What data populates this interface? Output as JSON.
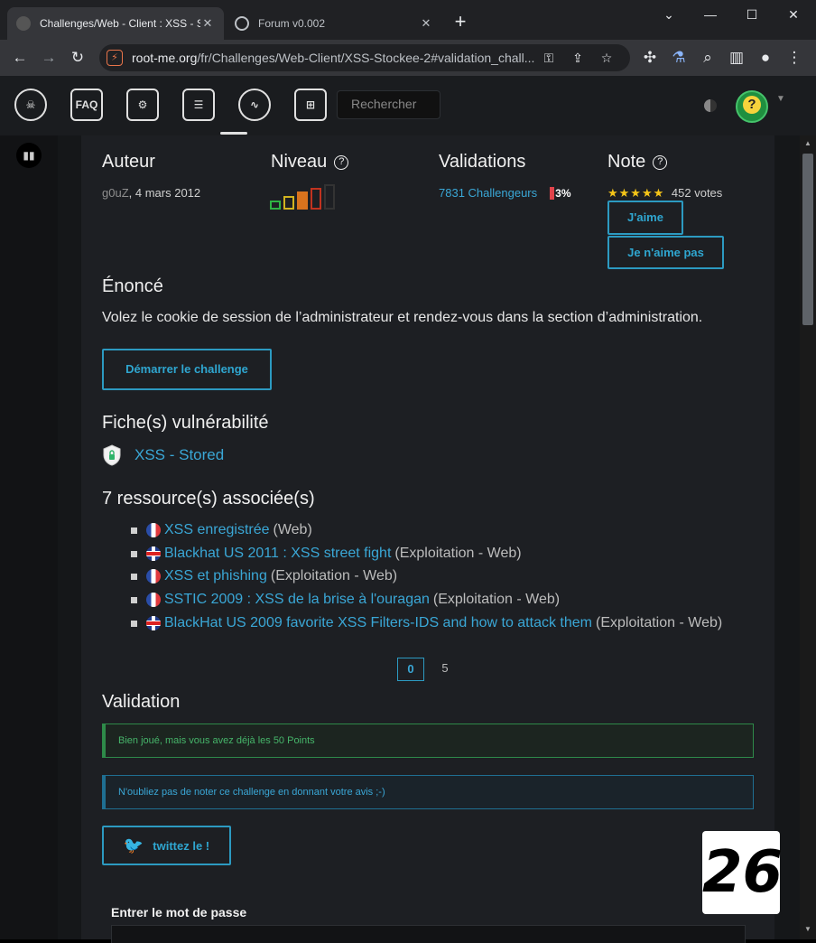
{
  "browser": {
    "tabs": [
      {
        "title": "Challenges/Web - Client : XSS - S",
        "close": "✕"
      },
      {
        "title": "Forum v0.002",
        "close": "✕"
      }
    ],
    "new_tab": "+",
    "window_controls": {
      "dropdown": "⌄",
      "minimize": "—",
      "maximize": "☐",
      "close": "✕"
    },
    "url_host": "root-me.org",
    "url_path": "/fr/Challenges/Web-Client/XSS-Stockee-2#validation_chall..."
  },
  "site_header": {
    "search_placeholder": "Rechercher",
    "nav_icons": [
      "skull-logo-icon",
      "faq-icon",
      "tools-icon",
      "documents-icon",
      "activity-icon",
      "shop-cart-icon"
    ]
  },
  "challenge": {
    "author_heading": "Auteur",
    "author_name": "g0uZ",
    "author_date": "4 mars 2012",
    "level_heading": "Niveau",
    "validations_heading": "Validations",
    "validations_link": "7831 Challengeurs",
    "validations_pct": "3%",
    "note_heading": "Note",
    "stars": "★★★★★",
    "votes": "452 votes",
    "like_button": "J'aime",
    "dislike_button": "Je n'aime pas",
    "statement_heading": "Énoncé",
    "statement_text": "Volez le cookie de session de l’administrateur et rendez-vous dans la section d’administration.",
    "start_button": "Démarrer le challenge",
    "vuln_heading": "Fiche(s) vulnérabilité",
    "vuln_link": "XSS - Stored",
    "resources_heading": "7 ressource(s) associée(s)",
    "resources": [
      {
        "flag": "fr",
        "title": "XSS enregistrée",
        "category": "(Web)"
      },
      {
        "flag": "gb",
        "title": "Blackhat US 2011 : XSS street fight",
        "category": "(Exploitation - Web)"
      },
      {
        "flag": "fr",
        "title": "XSS et phishing",
        "category": "(Exploitation - Web)"
      },
      {
        "flag": "fr",
        "title": "SSTIC 2009 : XSS de la brise à l'ouragan",
        "category": "(Exploitation - Web)"
      },
      {
        "flag": "gb",
        "title": "BlackHat US 2009 favorite XSS Filters-IDS and how to attack them",
        "category": "(Exploitation - Web)"
      }
    ],
    "pages": [
      "0",
      "5"
    ],
    "validation_heading": "Validation",
    "alert_success": "Bien joué, mais vous avez déjà les 50 Points",
    "alert_info": "N'oubliez pas de noter ce challenge en donnant votre avis ;-)",
    "tweet_button": "twittez le !",
    "password_label": "Entrer le mot de passe"
  },
  "overlay_badge": "26"
}
